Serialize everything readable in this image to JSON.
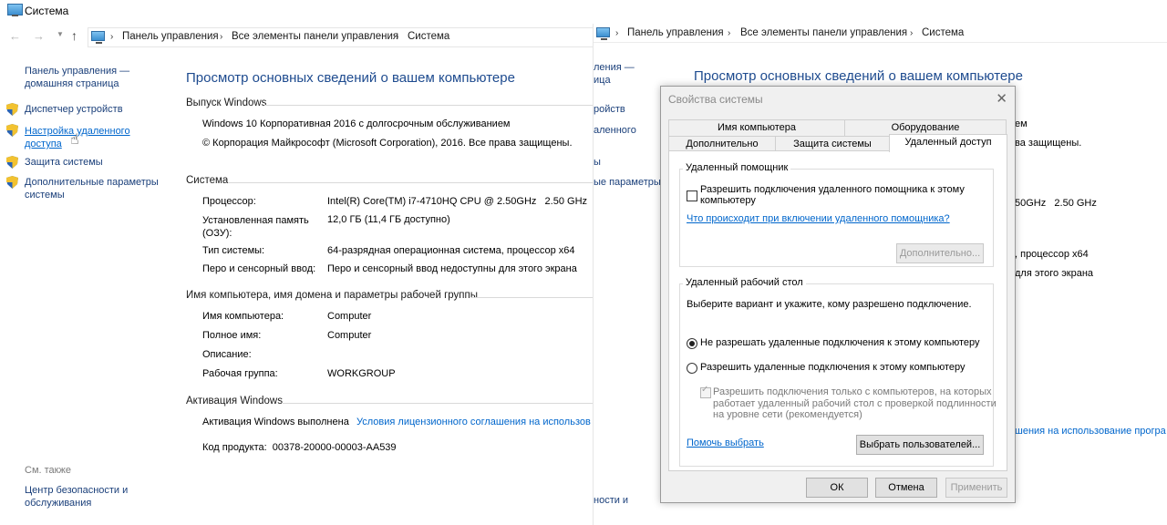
{
  "window": {
    "title": "Система"
  },
  "address_bar": {
    "crumbs": [
      "Панель управления",
      "Все элементы панели управления",
      "Система"
    ]
  },
  "sidebar": {
    "home_link": [
      "Панель управления —",
      "домашняя страница"
    ],
    "items": [
      {
        "label": [
          "Диспетчер устройств"
        ]
      },
      {
        "label": [
          "Настройка удаленного",
          "доступа"
        ]
      },
      {
        "label": [
          "Защита системы"
        ]
      },
      {
        "label": [
          "Дополнительные параметры",
          "системы"
        ]
      }
    ],
    "see_also_label": "См. также",
    "see_also_items": [
      {
        "label": [
          "Центр безопасности и",
          "обслуживания"
        ]
      }
    ]
  },
  "main": {
    "title": "Просмотр основных сведений о вашем компьютере",
    "edition": {
      "heading": "Выпуск Windows",
      "name": "Windows 10 Корпоративная 2016 с долгосрочным обслуживанием",
      "copyright": "© Корпорация Майкрософт (Microsoft Corporation), 2016. Все права защищены."
    },
    "system": {
      "heading": "Система",
      "rows": [
        {
          "label": "Процессор:",
          "value": "Intel(R) Core(TM) i7-4710HQ CPU @ 2.50GHz   2.50 GHz"
        },
        {
          "label": "Установленная память",
          "label2": "(ОЗУ):",
          "value": "12,0 ГБ (11,4 ГБ доступно)"
        },
        {
          "label": "Тип системы:",
          "value": "64-разрядная операционная система, процессор x64"
        },
        {
          "label": "Перо и сенсорный ввод:",
          "value": "Перо и сенсорный ввод недоступны для этого экрана"
        }
      ]
    },
    "computer": {
      "heading": "Имя компьютера, имя домена и параметры рабочей группы",
      "rows": [
        {
          "label": "Имя компьютера:",
          "value": "Computer"
        },
        {
          "label": "Полное имя:",
          "value": "Computer"
        },
        {
          "label": "Описание:",
          "value": ""
        },
        {
          "label": "Рабочая группа:",
          "value": "WORKGROUP"
        }
      ]
    },
    "activation": {
      "heading": "Активация Windows",
      "status": "Активация Windows выполнена",
      "license_link": "Условия лицензионного соглашения на использов",
      "product_key": "Код продукта:  00378-20000-00003-AA539"
    }
  },
  "background_window": {
    "crumbs": [
      "Панель управления",
      "Все элементы панели управления",
      "Система"
    ],
    "title": "Просмотр основных сведений о вашем компьютере",
    "sidebar_fragments": [
      "ления —",
      "ица",
      "ройств",
      "аленного",
      "ы",
      "ые параметры"
    ],
    "fragments": [
      "ем",
      "ва защищены.",
      "50GHz   2.50 GHz",
      ", процессор x64",
      "для этого экрана",
      "шения на использование програ",
      "ности и"
    ]
  },
  "dialog": {
    "title": "Свойства системы",
    "tabs_row1": [
      "Имя компьютера",
      "Оборудование"
    ],
    "tabs_row2": [
      "Дополнительно",
      "Защита системы",
      "Удаленный доступ"
    ],
    "remote_assistance": {
      "group_label": "Удаленный помощник",
      "checkbox_label": [
        "Разрешить подключения удаленного помощника к этому",
        "компьютеру"
      ],
      "help_link": "Что происходит при включении удаленного помощника?",
      "advanced_button": "Дополнительно..."
    },
    "remote_desktop": {
      "group_label": "Удаленный рабочий стол",
      "description": "Выберите вариант и укажите, кому разрешено подключение.",
      "radio_deny": "Не разрешать удаленные подключения к этому компьютеру",
      "radio_allow": "Разрешить удаленные подключения к этому компьютеру",
      "nla_checkbox": [
        "Разрешить подключения только с компьютеров, на которых",
        "работает удаленный рабочий стол с проверкой подлинности",
        "на уровне сети (рекомендуется)"
      ],
      "help_link": "Помочь выбрать",
      "select_users_button": "Выбрать пользователей..."
    },
    "buttons": {
      "ok": "ОК",
      "cancel": "Отмена",
      "apply": "Применить"
    }
  }
}
